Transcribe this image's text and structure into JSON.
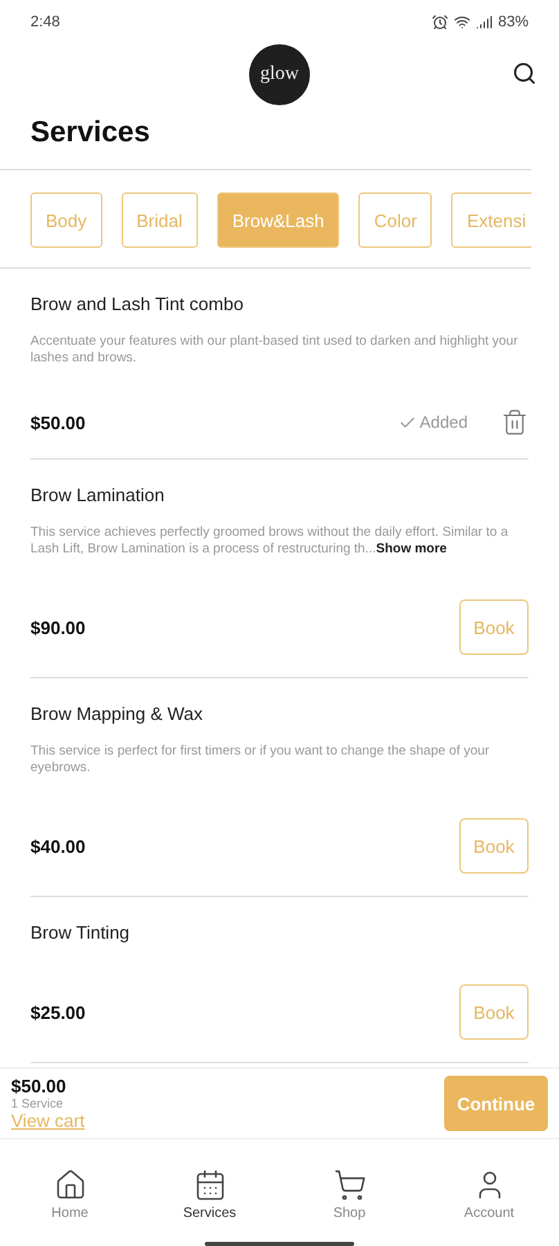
{
  "status_bar": {
    "time": "2:48",
    "battery": "83%"
  },
  "header": {
    "logo": "glow",
    "title": "Services"
  },
  "categories": [
    {
      "label": "Body",
      "selected": false
    },
    {
      "label": "Bridal",
      "selected": false
    },
    {
      "label": "Brow&Lash",
      "selected": true
    },
    {
      "label": "Color",
      "selected": false
    },
    {
      "label": "Extensi",
      "selected": false
    }
  ],
  "services": [
    {
      "name": "Brow and Lash Tint combo",
      "description": "Accentuate your features with our plant-based tint used to darken and highlight your lashes and brows.",
      "price": "$50.00",
      "added": true,
      "status": "Added"
    },
    {
      "name": "Brow Lamination",
      "description": "This service achieves perfectly groomed brows without the daily effort. Similar to a Lash Lift, Brow Lamination is a process of restructuring th...",
      "more": "Show more",
      "price": "$90.00",
      "added": false,
      "action": "Book"
    },
    {
      "name": "Brow Mapping & Wax",
      "description": "This service is perfect for first timers or if you want to change the shape of your eyebrows.",
      "price": "$40.00",
      "added": false,
      "action": "Book"
    },
    {
      "name": "Brow Tinting",
      "price": "$25.00",
      "added": false,
      "action": "Book"
    }
  ],
  "cart": {
    "total": "$50.00",
    "count": "1 Service",
    "link": "View cart",
    "button": "Continue"
  },
  "nav": [
    {
      "label": "Home",
      "selected": false
    },
    {
      "label": "Services",
      "selected": true
    },
    {
      "label": "Shop",
      "selected": false
    },
    {
      "label": "Account",
      "selected": false
    }
  ]
}
